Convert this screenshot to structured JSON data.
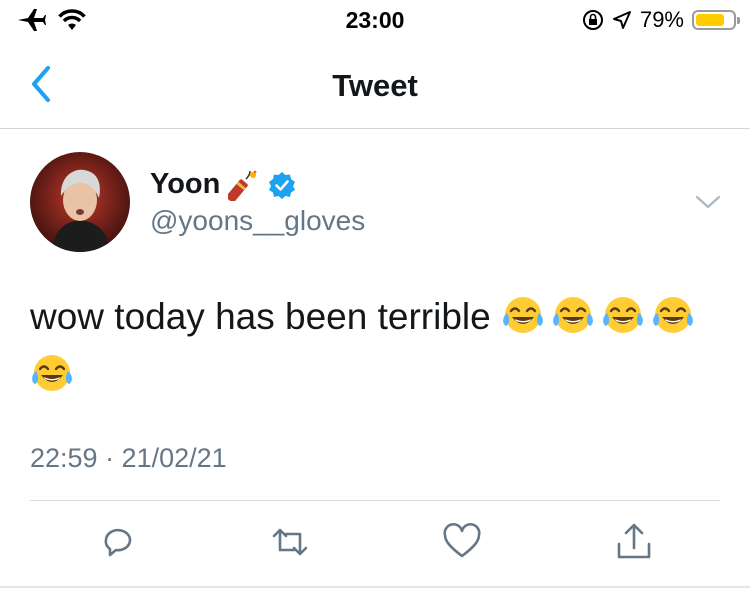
{
  "status_bar": {
    "time": "23:00",
    "battery_percent": "79%",
    "battery_level": 0.79,
    "icons": [
      "airplane-icon",
      "wifi-icon",
      "orientation-lock-icon",
      "location-icon",
      "battery-icon"
    ]
  },
  "nav": {
    "title": "Tweet",
    "back_icon": "chevron-left-icon"
  },
  "tweet": {
    "author_name": "Yoon",
    "author_badges": [
      "firecracker-emoji",
      "verified-badge-icon"
    ],
    "author_handle": "@yoons__gloves",
    "text": "wow today has been terrible",
    "trailing_emoji": "face-with-tears-of-joy",
    "trailing_emoji_count": 5,
    "timestamp": "22:59 · 21/02/21"
  },
  "actions": [
    "reply-icon",
    "retweet-icon",
    "like-icon",
    "share-icon"
  ],
  "colors": {
    "accent": "#1da1f2",
    "text": "#14171a",
    "secondary_text": "#657786",
    "battery": "#ffcc00"
  }
}
